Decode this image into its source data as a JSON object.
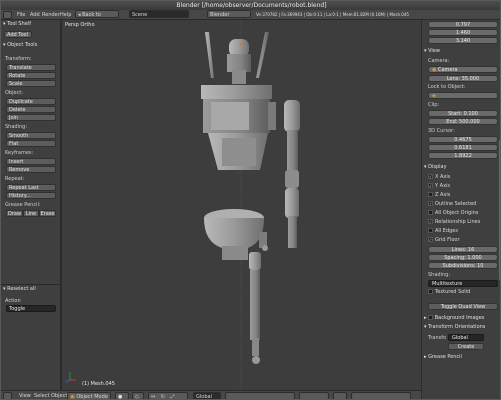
{
  "title": "Blender [/home/observer/Documents/robot.blend]",
  "topbar": {
    "menus": [
      "File",
      "Add",
      "Render",
      "Help"
    ],
    "back_to_previous": "Back to Previous",
    "scene": "Scene",
    "render_engine": "Blender Render",
    "stats": "Ve:370782 | Fa:369943 | Ob:0-11 | La:0-1 | Mem:81.82M (0.16M) | Mesh.045"
  },
  "left_panel": {
    "tool_shelf": "Tool Shelf",
    "add_tool": "Add Tool",
    "object_tools": "Object Tools",
    "transform": "Transform:",
    "translate": "Translate",
    "rotate": "Rotate",
    "scale": "Scale",
    "object": "Object:",
    "duplicate": "Duplicate",
    "delete": "Delete",
    "join": "Join",
    "shading": "Shading:",
    "smooth": "Smooth",
    "flat": "Flat",
    "keyframes": "Keyframes:",
    "insert": "Insert",
    "remove": "Remove",
    "repeat": "Repeat:",
    "repeat_last": "Repeat Last",
    "history": "History...",
    "grease_pencil": "Grease Pencil:",
    "draw_modes": [
      "Draw",
      "Line",
      "Erase"
    ],
    "operator_title": "Reselect all",
    "action": "Action",
    "action_value": "Toggle"
  },
  "viewport": {
    "label": "Persp Ortho",
    "info": "(1) Mesh.045"
  },
  "right_panel": {
    "values_top": [
      "0.797",
      "1.460",
      "3.140"
    ],
    "view": "View",
    "camera_label": "Camera:",
    "camera_value": "Camera",
    "lens": "Lens: 35.000",
    "lock_to_object": "Lock to Object:",
    "clip": "Clip:",
    "clip_start": "Start: 0.100",
    "clip_end": "End: 500.000",
    "cursor_3d": "3D Cursor:",
    "cursor_values": [
      "0.4675",
      "0.6181",
      "1.8922"
    ],
    "display": "Display",
    "display_checks": [
      {
        "label": "X Axis",
        "checked": true
      },
      {
        "label": "Y Axis",
        "checked": true
      },
      {
        "label": "Z Axis",
        "checked": false
      },
      {
        "label": "Outline Selected",
        "checked": true
      },
      {
        "label": "All Object Origins",
        "checked": false
      },
      {
        "label": "Relationship Lines",
        "checked": true
      },
      {
        "label": "All Edges",
        "checked": false
      },
      {
        "label": "Grid Floor",
        "checked": true
      }
    ],
    "lines": "Lines: 16",
    "spacing": "Spacing: 1.000",
    "subdivisions": "Subdivisions: 10",
    "shading": "Shading:",
    "multitexture": "Multitexture",
    "textured_solid": "Textured Solid",
    "toggle_quad_view": "Toggle Quad View",
    "background_images": "Background Images",
    "transform_orientations": "Transform Orientations",
    "transform_label": "Transfo",
    "transform_value": "Global",
    "create": "Create",
    "grease_pencil": "Grease Pencil"
  },
  "statusbar": {
    "items": [
      "View",
      "Select",
      "Object"
    ],
    "mode": "Object Mode",
    "orientation": "Global"
  }
}
